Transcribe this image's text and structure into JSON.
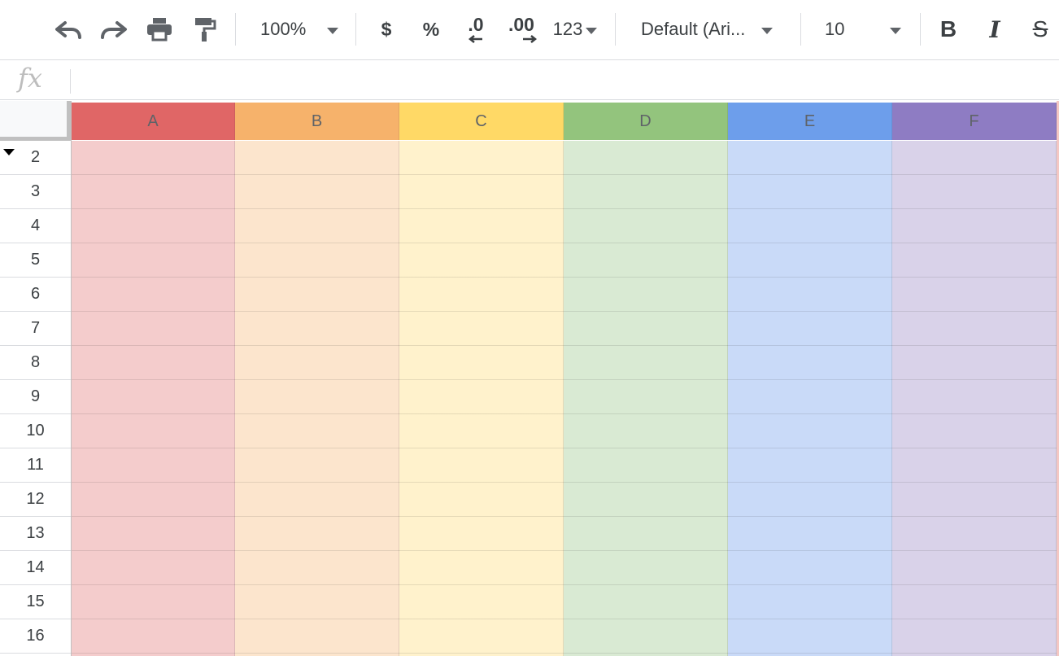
{
  "toolbar": {
    "zoom": "100%",
    "currency": "$",
    "percent": "%",
    "decrease_decimal": ".0",
    "increase_decimal": ".00",
    "more_formats": "123",
    "font": "Default (Ari...",
    "font_size": "10",
    "bold": "B",
    "italic": "I",
    "strike": "S"
  },
  "formula_bar": {
    "fx": "fx",
    "value": ""
  },
  "columns": [
    {
      "label": "A",
      "header_color": "#e06666",
      "cell_color": "#f4cccc"
    },
    {
      "label": "B",
      "header_color": "#f6b26b",
      "cell_color": "#fce5cd"
    },
    {
      "label": "C",
      "header_color": "#ffd966",
      "cell_color": "#fff2cc"
    },
    {
      "label": "D",
      "header_color": "#93c47d",
      "cell_color": "#d9ead3"
    },
    {
      "label": "E",
      "header_color": "#6d9eeb",
      "cell_color": "#c9daf8"
    },
    {
      "label": "F",
      "header_color": "#8e7cc3",
      "cell_color": "#d9d2e9"
    }
  ],
  "rows": [
    "2",
    "3",
    "4",
    "5",
    "6",
    "7",
    "8",
    "9",
    "10",
    "11",
    "12",
    "13",
    "14",
    "15",
    "16"
  ]
}
